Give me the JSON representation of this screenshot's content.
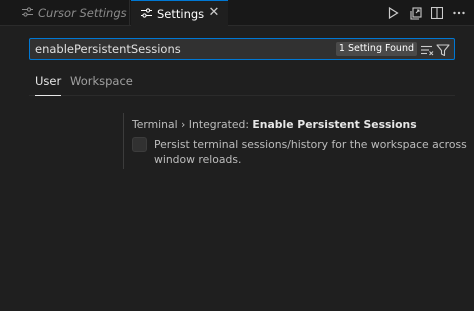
{
  "tabs": [
    {
      "label": "Cursor Settings",
      "icon": "settings-editor-icon",
      "active": false
    },
    {
      "label": "Settings",
      "icon": "settings-editor-icon",
      "active": true
    }
  ],
  "tab_close_glyph": "✕",
  "editor_actions": [
    "run-icon",
    "open-json-icon",
    "split-editor-icon",
    "more-actions-icon"
  ],
  "search": {
    "value": "enablePersistentSessions",
    "result_badge": "1 Setting Found"
  },
  "scope_tabs": [
    "User",
    "Workspace"
  ],
  "setting": {
    "breadcrumb": "Terminal › Integrated: ",
    "name": "Enable Persistent Sessions",
    "description": "Persist terminal sessions/history for the workspace across window reloads.",
    "checked": false
  },
  "colors": {
    "accent": "#0078d4",
    "background": "#1f1f1f",
    "tabbar": "#181818"
  }
}
